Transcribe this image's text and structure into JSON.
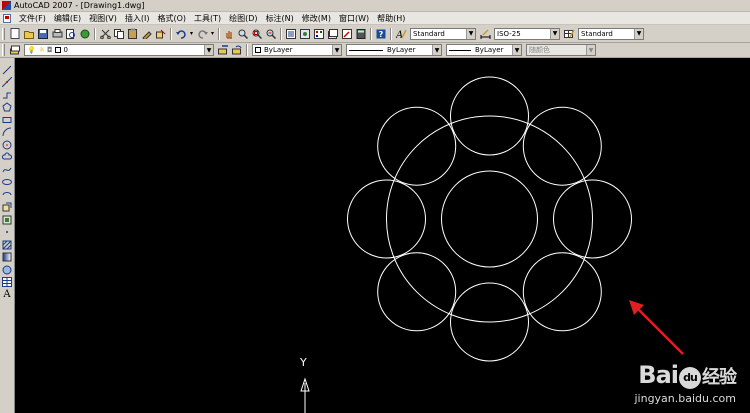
{
  "window": {
    "title": "AutoCAD 2007 - [Drawing1.dwg]"
  },
  "menu": [
    {
      "label": "文件(F)"
    },
    {
      "label": "编辑(E)"
    },
    {
      "label": "视图(V)"
    },
    {
      "label": "插入(I)"
    },
    {
      "label": "格式(O)"
    },
    {
      "label": "工具(T)"
    },
    {
      "label": "绘图(D)"
    },
    {
      "label": "标注(N)"
    },
    {
      "label": "修改(M)"
    },
    {
      "label": "窗口(W)"
    },
    {
      "label": "帮助(H)"
    }
  ],
  "styles_toolbar": {
    "text_style": "Standard",
    "dim_style": "ISO-25",
    "table_style": "Standard"
  },
  "layers_toolbar": {
    "current_layer": "0",
    "color": "ByLayer",
    "linetype": "ByLayer",
    "lineweight": "ByLayer",
    "plot_style": "随颜色"
  },
  "ucs": {
    "y_label": "Y"
  },
  "watermark": {
    "logo_left": "Bai",
    "logo_paw": "du",
    "logo_right": "经验",
    "url": "jingyan.baidu.com"
  },
  "colors": {
    "canvas": "#000000",
    "geometry": "#ffffff",
    "annotation_arrow": "#e02020"
  }
}
